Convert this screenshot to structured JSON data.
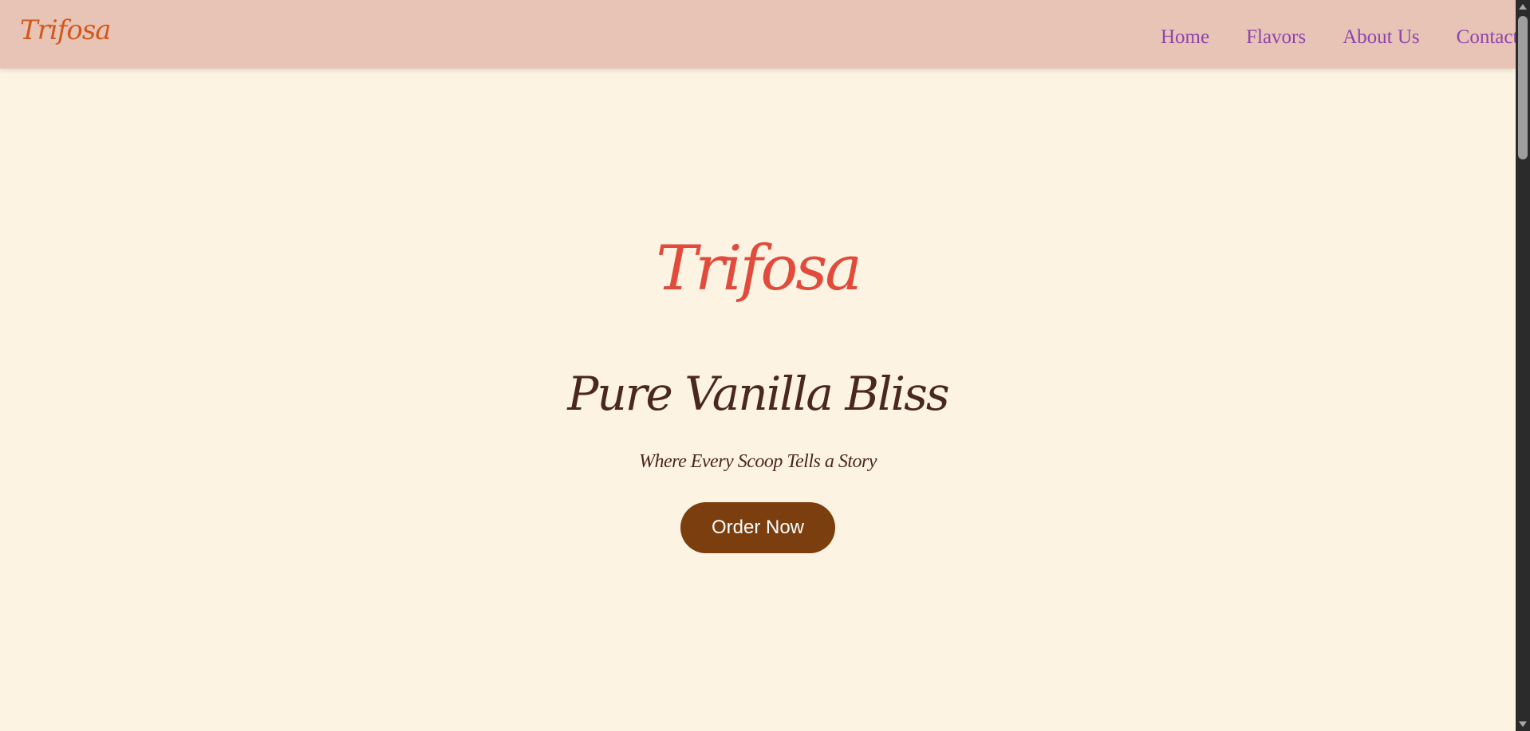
{
  "navbar": {
    "logo": "Trifosa",
    "links": [
      "Home",
      "Flavors",
      "About Us",
      "Contact"
    ]
  },
  "hero": {
    "logo": "Trifosa",
    "title": "Pure Vanilla Bliss",
    "subtitle": "Where Every Scoop Tells a Story",
    "button_label": "Order Now"
  },
  "colors": {
    "navbar_bg": "#e8c4b6",
    "page_bg": "#fdf3e3",
    "nav_logo": "#d2591e",
    "nav_link": "#8e44ad",
    "hero_logo": "#e14b3b",
    "title_text": "#4a2720",
    "button_bg": "#7b3e0e",
    "button_text": "#ffffff"
  },
  "scrollbar": {
    "icons": [
      "scroll-up-arrow-icon",
      "scroll-down-arrow-icon"
    ]
  }
}
